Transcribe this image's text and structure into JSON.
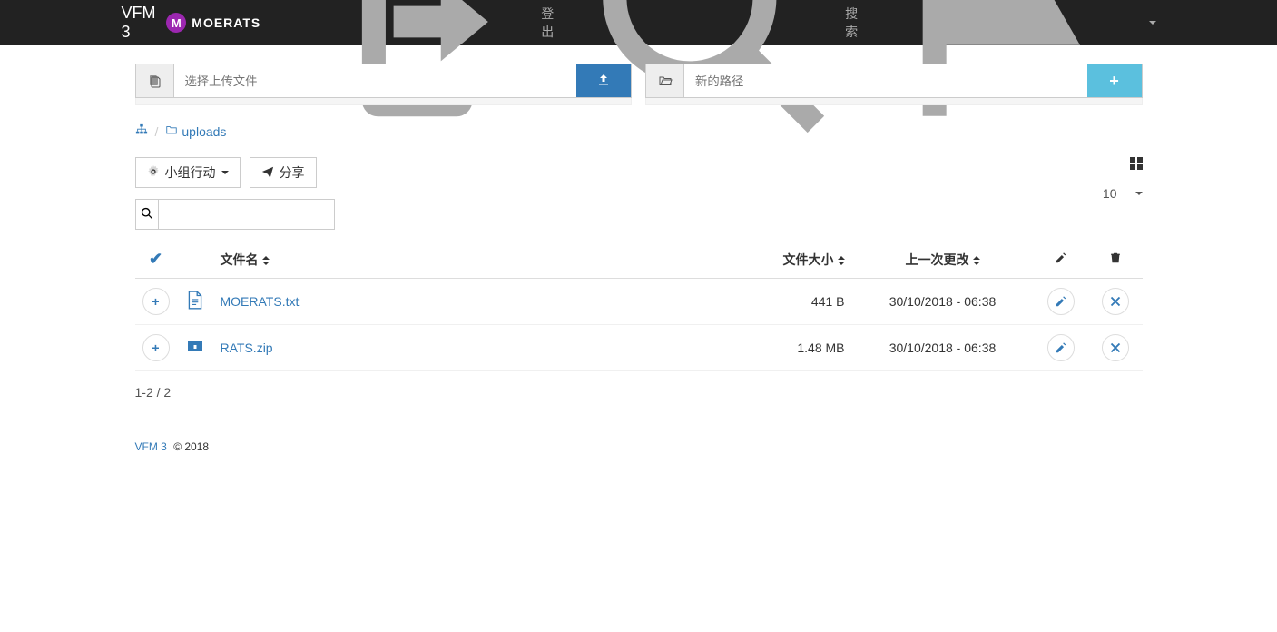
{
  "nav": {
    "brand": "VFM 3",
    "user": "MOERATS",
    "avatar_letter": "M",
    "logout": "登出",
    "search": "搜索"
  },
  "upload": {
    "placeholder": "选择上传文件",
    "folder_placeholder": "新的路径"
  },
  "breadcrumb": {
    "current": "uploads"
  },
  "toolbar": {
    "group_action": "小组行动",
    "share": "分享"
  },
  "page_size": "10",
  "headers": {
    "filename": "文件名",
    "filesize": "文件大小",
    "last_modified": "上一次更改"
  },
  "files": [
    {
      "name": "MOERATS.txt",
      "size": "441 B",
      "modified": "30/10/2018 - 06:38",
      "type": "txt"
    },
    {
      "name": "RATS.zip",
      "size": "1.48 MB",
      "modified": "30/10/2018 - 06:38",
      "type": "zip"
    }
  ],
  "pagination": "1-2 / 2",
  "footer": {
    "brand": "VFM 3",
    "copyright": "© 2018"
  }
}
